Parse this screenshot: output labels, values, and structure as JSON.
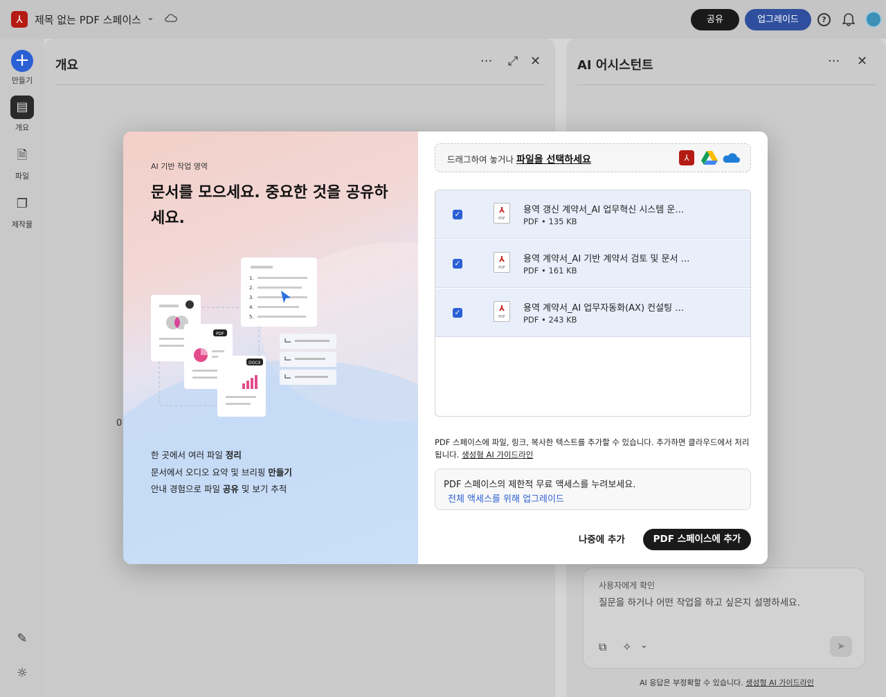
{
  "topbar": {
    "title": "제목 없는 PDF 스페이스",
    "share_label": "공유",
    "upgrade_label": "업그레이드",
    "help_glyph": "?"
  },
  "nav": {
    "create": "만들기",
    "overview": "개요",
    "files": "파일",
    "outputs": "제작물"
  },
  "left_panel": {
    "title": "개요",
    "zero_label": "0"
  },
  "right_panel": {
    "title": "AI 어시스턴트",
    "chat_label": "사용자에게 확인",
    "chat_prompt": "질문을 하거나 어떤 작업을 하고 싶은지 설명하세요.",
    "disclaimer_text": "AI 응답은 부정확할 수 있습니다.",
    "disclaimer_link": "생성형 AI 가이드라인"
  },
  "modal": {
    "eyebrow": "AI 기반 작업 영역",
    "headline": "문서를 모으세요. 중요한 것을 공유하세요.",
    "bullets": [
      {
        "text": "한 곳에서 여러 파일 ",
        "bold": "정리",
        "after": ""
      },
      {
        "text": "문서에서 오디오 요약 및 브리핑 ",
        "bold": "만들기",
        "after": ""
      },
      {
        "text": "안내 경험으로 파일 ",
        "bold": "공유",
        "after": " 및 보기 추적"
      }
    ],
    "dropzone": {
      "text": "드래그하여 놓거나 ",
      "link": "파일을 선택하세요"
    },
    "files": [
      {
        "name": "용역 갱신 계약서_AI 업무혁신 시스템 운…",
        "meta": "PDF • 135 KB",
        "checked": true
      },
      {
        "name": "용역 계약서_AI 기반 계약서 검토 및 문서 …",
        "meta": "PDF • 161 KB",
        "checked": true
      },
      {
        "name": "용역 계약서_AI 업무자동화(AX) 컨설팅 …",
        "meta": "PDF • 243 KB",
        "checked": true
      }
    ],
    "file_icon_label": "PDF",
    "info_text": "PDF 스페이스에 파일, 링크, 복사한 텍스트를 추가할 수 있습니다. 추가하면 클라우드에서 처리됩니다. ",
    "info_link": "생성형 AI 가이드라인",
    "promo_text": "PDF 스페이스의 제한적 무료 액세스를 누려보세요.",
    "promo_link": "전체 액세스를 위해 업그레이드",
    "later_label": "나중에 추가",
    "add_label": "PDF 스페이스에 추가"
  },
  "illustration": {
    "pdf_tag": "PDF",
    "docx_tag": "DOCX",
    "list_numbers": [
      "1.",
      "2.",
      "3.",
      "4.",
      "5."
    ]
  },
  "colors": {
    "accent_blue": "#2b5fd4",
    "adobe_red": "#b31b13",
    "dark_button": "#1a1a1a",
    "file_row_bg": "#e8eefa"
  }
}
